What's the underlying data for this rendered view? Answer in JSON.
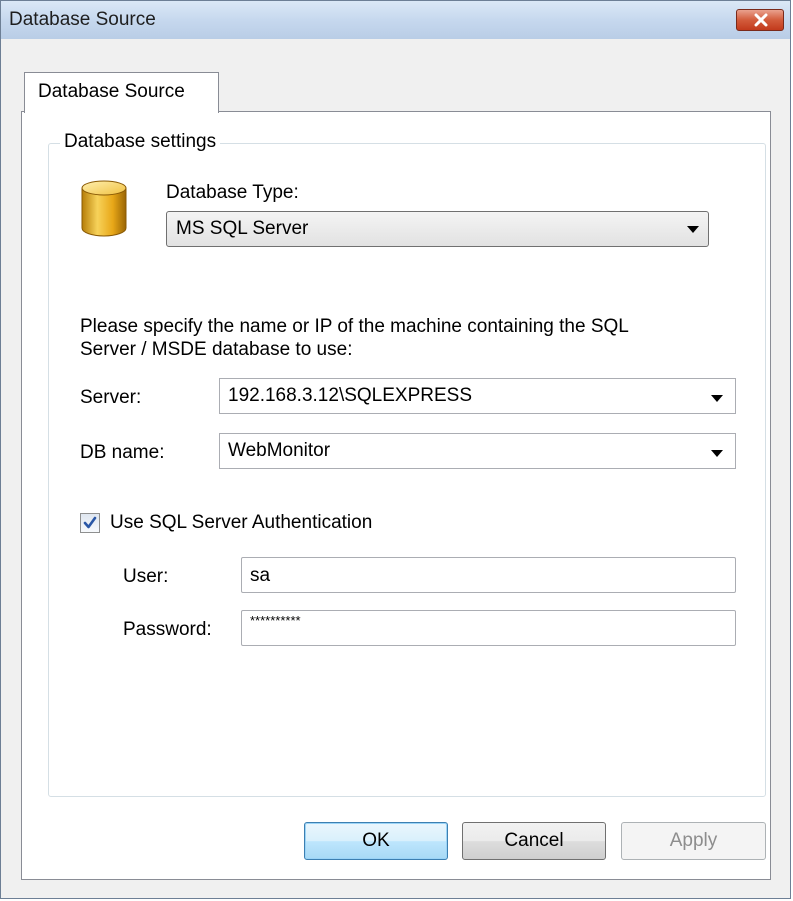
{
  "window": {
    "title": "Database Source"
  },
  "tabs": [
    {
      "label": "Database Source",
      "active": true
    }
  ],
  "group": {
    "title": "Database settings",
    "icon": "database-icon",
    "db_type_label": "Database Type:",
    "db_type_value": "MS SQL Server",
    "instructions_line1": "Please specify the name or IP of the machine containing the SQL",
    "instructions_line2": "Server / MSDE database to use:",
    "server_label": "Server:",
    "server_value": "192.168.3.12\\SQLEXPRESS",
    "dbname_label": "DB name:",
    "dbname_value": "WebMonitor",
    "auth_checkbox_label": "Use SQL Server Authentication",
    "auth_checked": true,
    "user_label": "User:",
    "user_value": "sa",
    "password_label": "Password:",
    "password_value": "**********"
  },
  "buttons": {
    "ok": "OK",
    "cancel": "Cancel",
    "apply": "Apply"
  },
  "colors": {
    "close_button": "#c23a1c",
    "checkmark": "#2a57a6",
    "default_button_border": "#3c7fb1"
  }
}
